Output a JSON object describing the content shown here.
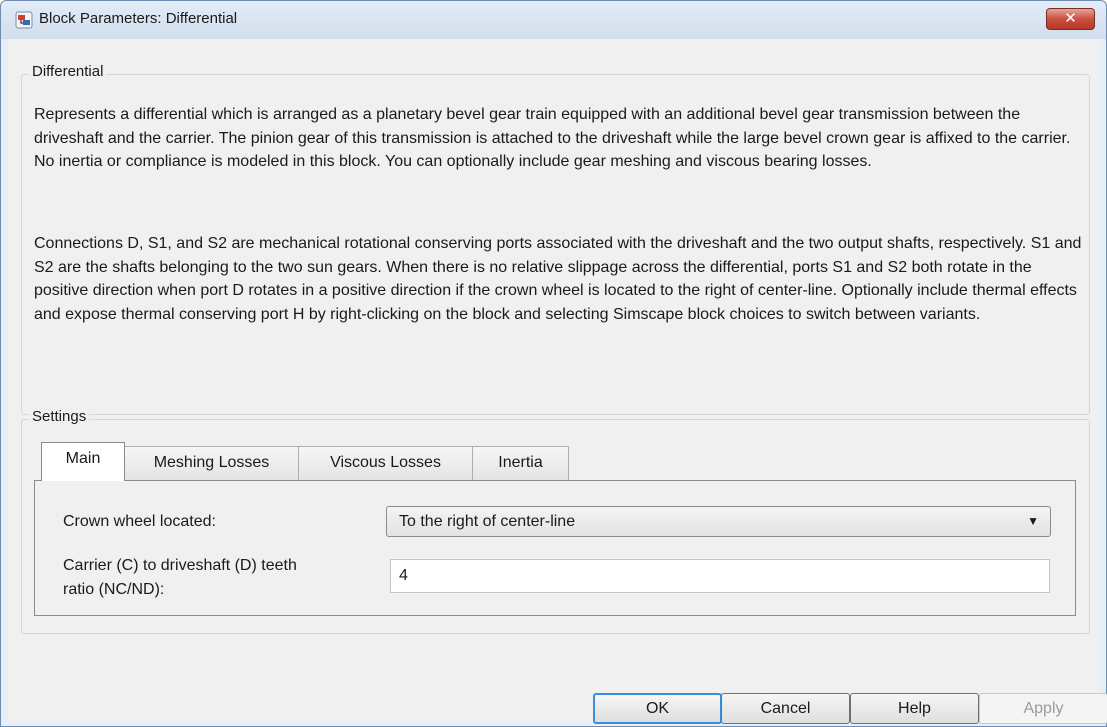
{
  "window": {
    "title": "Block Parameters: Differential",
    "close_symbol": "✕"
  },
  "description": {
    "group_label": "Differential",
    "paragraphs": [
      "Represents a differential which is arranged as a planetary bevel gear train equipped with an additional bevel gear transmission between the driveshaft and the carrier. The pinion gear of this transmission is attached to the driveshaft while the large bevel crown gear is affixed to the carrier. No inertia or compliance is modeled in this block. You can optionally include gear meshing and viscous bearing losses.",
      "Connections D, S1, and S2 are mechanical rotational conserving ports associated with the driveshaft and the two output shafts, respectively. S1 and S2 are the shafts belonging to the two sun gears. When there is no relative slippage across the differential, ports S1 and S2 both rotate in the positive direction when port D rotates in a positive direction if the crown wheel is located to the right of center-line. Optionally include thermal effects and expose thermal conserving port H by right-clicking on the block and selecting Simscape block choices to switch between variants."
    ]
  },
  "settings": {
    "group_label": "Settings",
    "tabs": [
      {
        "label": "Main",
        "active": true
      },
      {
        "label": "Meshing Losses",
        "active": false
      },
      {
        "label": "Viscous Losses",
        "active": false
      },
      {
        "label": "Inertia",
        "active": false
      }
    ],
    "crown_wheel": {
      "label": "Crown wheel located:",
      "value": "To the right of center-line"
    },
    "teeth_ratio": {
      "label_line1": "Carrier (C) to driveshaft (D) teeth",
      "label_line2": "ratio (NC/ND):",
      "value": "4"
    }
  },
  "buttons": {
    "ok": "OK",
    "cancel": "Cancel",
    "help": "Help",
    "apply": "Apply"
  }
}
